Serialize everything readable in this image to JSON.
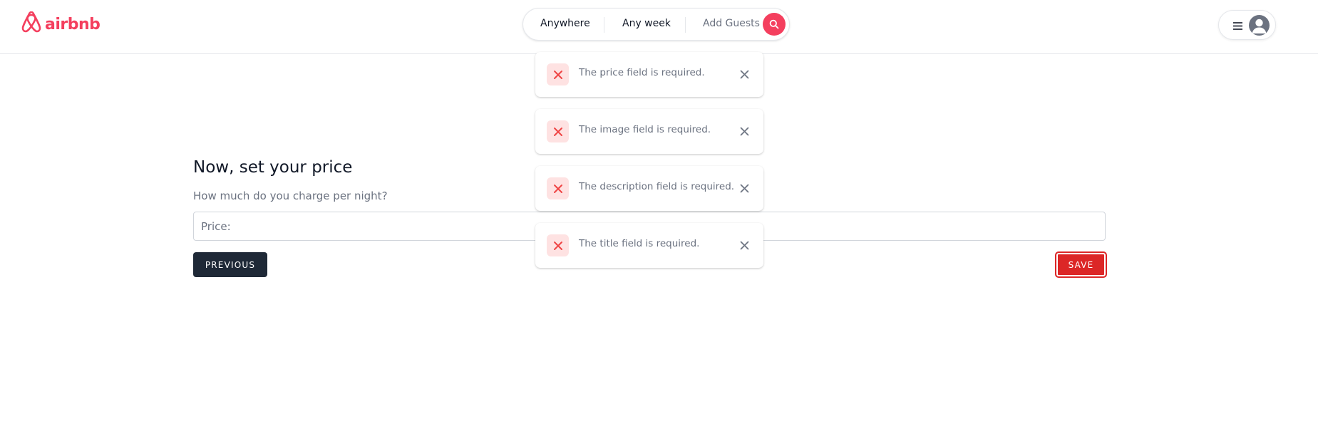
{
  "brand": {
    "name": "airbnb",
    "color": "#f43f5e"
  },
  "search": {
    "location": "Anywhere",
    "week": "Any week",
    "guests": "Add Guests",
    "icon": "search-icon"
  },
  "user_menu": {
    "menu_icon": "hamburger-icon",
    "avatar_icon": "avatar-placeholder"
  },
  "form": {
    "title": "Now, set your price",
    "subtitle": "How much do you charge per night?",
    "price_placeholder": "Price:",
    "price_value": "",
    "previous_label": "PREVIOUS",
    "save_label": "SAVE"
  },
  "toasts": [
    {
      "message": "The price field is required.",
      "type": "error"
    },
    {
      "message": "The image field is required.",
      "type": "error"
    },
    {
      "message": "The description field is required.",
      "type": "error"
    },
    {
      "message": "The title field is required.",
      "type": "error"
    }
  ],
  "colors": {
    "accent": "#f43f5e",
    "danger": "#dc2626",
    "dark_button": "#1f2937",
    "error_bg": "#fee2e2",
    "error_icon": "#ef4444"
  }
}
